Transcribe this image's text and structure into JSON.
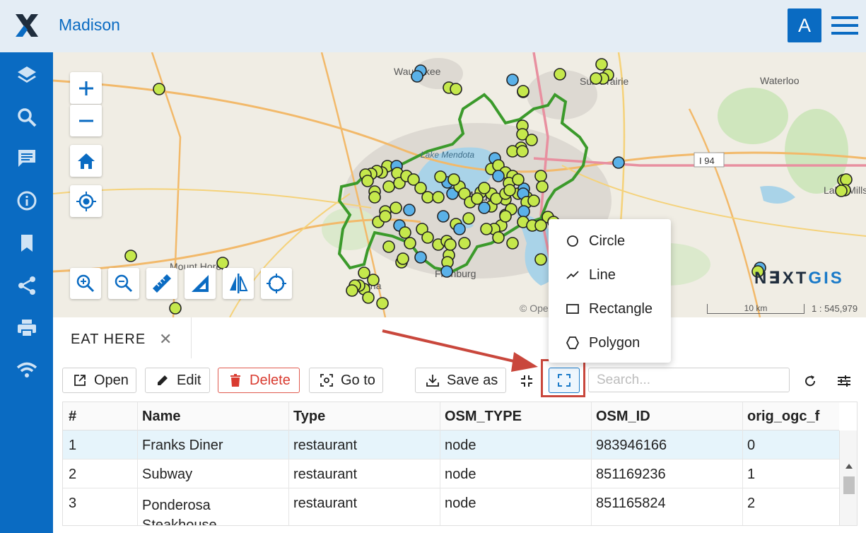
{
  "header": {
    "title": "Madison",
    "avatar_letter": "A"
  },
  "sidebar": {
    "items": [
      "layers-icon",
      "search-icon",
      "chat-icon",
      "info-icon",
      "bookmark-icon",
      "share-icon",
      "print-icon",
      "wifi-icon"
    ]
  },
  "map": {
    "place_labels": [
      "Waunakee",
      "Sun Prairie",
      "Waterloo",
      "Lake Mendota",
      "I 94",
      "Madison",
      "Mount Horeb",
      "Fitchburg",
      "Verona",
      "Lake Mills"
    ],
    "attribution": "© OpenStreetMap contributors.",
    "scale_label": "10 km",
    "scale_ratio": "1 : 545,979",
    "logo_text_a": "N∃XT",
    "logo_text_b": "GIS",
    "colors": {
      "point_fill": "#c5e84c",
      "point_alt": "#5ab1e8",
      "boundary": "#3b9a2b",
      "water": "#a9d3e8"
    }
  },
  "draw_menu": {
    "items": [
      {
        "label": "Circle",
        "icon": "circle-icon"
      },
      {
        "label": "Line",
        "icon": "line-icon"
      },
      {
        "label": "Rectangle",
        "icon": "rectangle-icon"
      },
      {
        "label": "Polygon",
        "icon": "polygon-icon"
      }
    ]
  },
  "panel": {
    "tab_label": "EAT HERE",
    "toolbar": {
      "open": "Open",
      "edit": "Edit",
      "delete": "Delete",
      "goto": "Go to",
      "save_as": "Save as",
      "search_placeholder": "Search..."
    },
    "table": {
      "columns": [
        "#",
        "Name",
        "Type",
        "OSM_TYPE",
        "OSM_ID",
        "orig_ogc_f"
      ],
      "rows": [
        [
          "1",
          "Franks Diner",
          "restaurant",
          "node",
          "983946166",
          "0"
        ],
        [
          "2",
          "Subway",
          "restaurant",
          "node",
          "851169236",
          "1"
        ],
        [
          "3",
          "Ponderosa Steakhouse",
          "restaurant",
          "node",
          "851165824",
          "2"
        ]
      ]
    }
  }
}
